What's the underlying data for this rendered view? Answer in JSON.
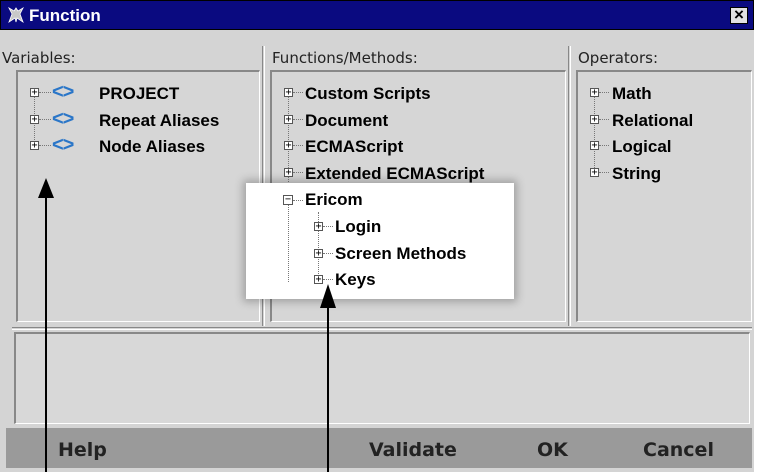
{
  "window": {
    "title": "Function"
  },
  "panels": {
    "variables": {
      "label": "Variables:",
      "items": [
        "PROJECT",
        "Repeat Aliases",
        "Node Aliases"
      ]
    },
    "functions": {
      "label": "Functions/Methods:",
      "items": [
        "Custom Scripts",
        "Document",
        "ECMAScript",
        "Extended ECMAScript"
      ],
      "expanded": {
        "label": "Ericom",
        "children": [
          "Login",
          "Screen Methods",
          "Keys"
        ]
      }
    },
    "operators": {
      "label": "Operators:",
      "items": [
        "Math",
        "Relational",
        "Logical",
        "String"
      ]
    }
  },
  "buttons": {
    "help": "Help",
    "validate": "Validate",
    "ok": "OK",
    "cancel": "Cancel"
  },
  "icons": {
    "title": "function-tool-icon",
    "close": "close-icon",
    "variable": "variable-diamond-icon"
  },
  "colors": {
    "titlebar": "#0a0a80",
    "icon_blue": "#2a76c8",
    "panel": "#d6d6d6",
    "buttonbar": "#9a9a9a"
  }
}
